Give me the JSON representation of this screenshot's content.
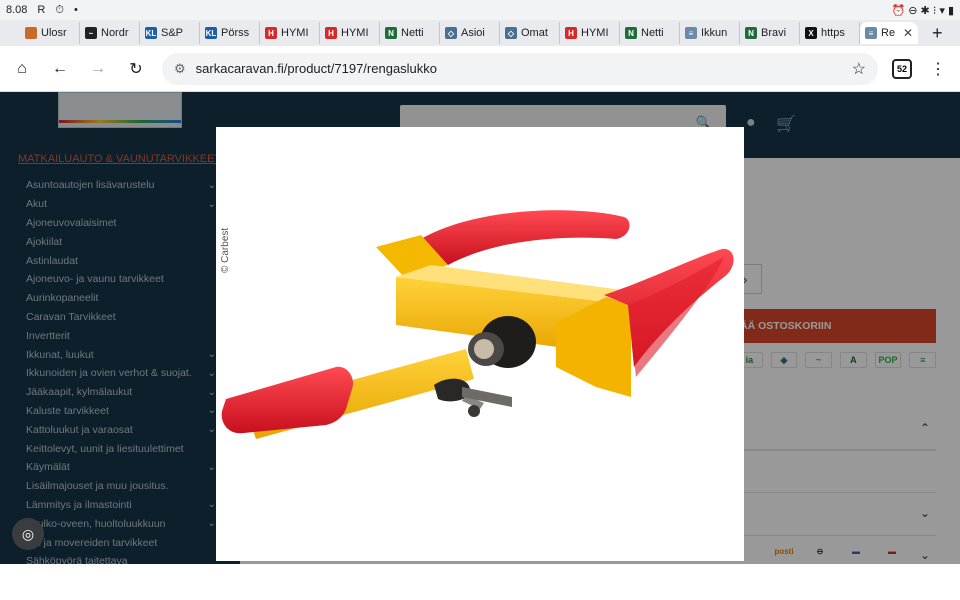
{
  "status_bar": {
    "time": "8.08",
    "left_icons": [
      "R",
      "⏱",
      "•"
    ],
    "right_icons": "⏰ ⊖ ✱ ⁝ ▾ ▮"
  },
  "tabs": [
    {
      "label": "Ulosr",
      "icon_color": "#c96a2a",
      "icon_char": ""
    },
    {
      "label": "Nordr",
      "icon_color": "#222222",
      "icon_char": "~"
    },
    {
      "label": "S&P",
      "icon_color": "#1b5fa8",
      "icon_char": "KL"
    },
    {
      "label": "Pörss",
      "icon_color": "#1b5fa8",
      "icon_char": "KL"
    },
    {
      "label": "HYMI",
      "icon_color": "#d42a2a",
      "icon_char": "H"
    },
    {
      "label": "HYMI",
      "icon_color": "#d42a2a",
      "icon_char": "H"
    },
    {
      "label": "Netti",
      "icon_color": "#1f6b3a",
      "icon_char": "N"
    },
    {
      "label": "Asioi",
      "icon_color": "#4a6f8f",
      "icon_char": "◇"
    },
    {
      "label": "Omat",
      "icon_color": "#4a6f8f",
      "icon_char": "◇"
    },
    {
      "label": "HYMI",
      "icon_color": "#d42a2a",
      "icon_char": "H"
    },
    {
      "label": "Netti",
      "icon_color": "#1f6b3a",
      "icon_char": "N"
    },
    {
      "label": "Ikkun",
      "icon_color": "#6a8aa8",
      "icon_char": "≡"
    },
    {
      "label": "Bravi",
      "icon_color": "#1f6b3a",
      "icon_char": "N"
    },
    {
      "label": "https",
      "icon_color": "#111111",
      "icon_char": "X"
    },
    {
      "label": "Re",
      "icon_color": "#6a8aa8",
      "icon_char": "≡",
      "active": true,
      "close": "✕"
    }
  ],
  "new_tab_glyph": "+",
  "toolbar": {
    "home": "⌂",
    "back": "←",
    "forward": "→",
    "reload": "↻",
    "site_settings": "⚙",
    "url": "sarkacaravan.fi/product/7197/rengaslukko",
    "bookmark": "☆",
    "tab_count": "52",
    "menu": "⋮"
  },
  "header": {
    "search_icon": "🔍",
    "account_icon": "●",
    "cart_icon": "🛒"
  },
  "sidebar": {
    "category_title": "MATKAILUAUTO & VAUNUTARVIKKEET",
    "category_chevron": "⌃",
    "items": [
      {
        "label": "Asuntoautojen lisävarustelu",
        "expandable": true
      },
      {
        "label": "Akut",
        "expandable": true
      },
      {
        "label": "Ajoneuvovalaisimet",
        "expandable": false
      },
      {
        "label": "Ajokiilat",
        "expandable": false
      },
      {
        "label": "Astinlaudat",
        "expandable": false
      },
      {
        "label": "Ajoneuvo- ja vaunu tarvikkeet",
        "expandable": false
      },
      {
        "label": "Aurinkopaneelit",
        "expandable": false
      },
      {
        "label": "Caravan Tarvikkeet",
        "expandable": false
      },
      {
        "label": "Invertterit",
        "expandable": false
      },
      {
        "label": "Ikkunat, luukut",
        "expandable": true
      },
      {
        "label": "Ikkunoiden ja ovien verhot & suojat.",
        "expandable": true
      },
      {
        "label": "Jääkaapit, kylmälaukut",
        "expandable": true
      },
      {
        "label": "Kaluste tarvikkeet",
        "expandable": true
      },
      {
        "label": "Kattoluukut ja varaosat",
        "expandable": true
      },
      {
        "label": "Keittolevyt, uunit ja liesituulettimet",
        "expandable": false
      },
      {
        "label": "Käymälät",
        "expandable": true
      },
      {
        "label": "Lisäilmajouset ja muu jousitus.",
        "expandable": false
      },
      {
        "label": "Lämmitys ja ilmastointi",
        "expandable": true
      },
      {
        "label": "ot ulko-oveen, huoltoluukkuun",
        "expandable": true
      },
      {
        "label": "erit ja movereiden tarvikkeet",
        "expandable": false
      },
      {
        "label": "Sähköpyörä taitettava",
        "expandable": false
      }
    ],
    "chevron": "⌄"
  },
  "product_panel": {
    "qty_arrow": "›",
    "add_to_cart": "ÄÄ OSTOSKORIIN",
    "payment_logos": [
      {
        "label": "ia",
        "color": "#2e8b3e"
      },
      {
        "label": "◈",
        "color": "#2a6d6d"
      },
      {
        "label": "~",
        "color": "#5aa05a"
      },
      {
        "label": "A",
        "color": "#1f5f36"
      },
      {
        "label": "POP",
        "color": "#2db04a"
      },
      {
        "label": "≡",
        "color": "#2e8b3e"
      }
    ],
    "accordion_chevrons": [
      "⌃",
      "⌄",
      "⌄"
    ],
    "shipping_logos": [
      {
        "label": "posti",
        "color": "#f07d00"
      },
      {
        "label": "⊖",
        "color": "#1b3c79"
      },
      {
        "label": "▬",
        "color": "#3c64aa"
      },
      {
        "label": "▬",
        "color": "#d42a2a"
      }
    ]
  },
  "lightbox": {
    "credit": "© Carbest",
    "image_subject": "wheel-clamp-lock"
  },
  "fingerprint_icon": "◎"
}
